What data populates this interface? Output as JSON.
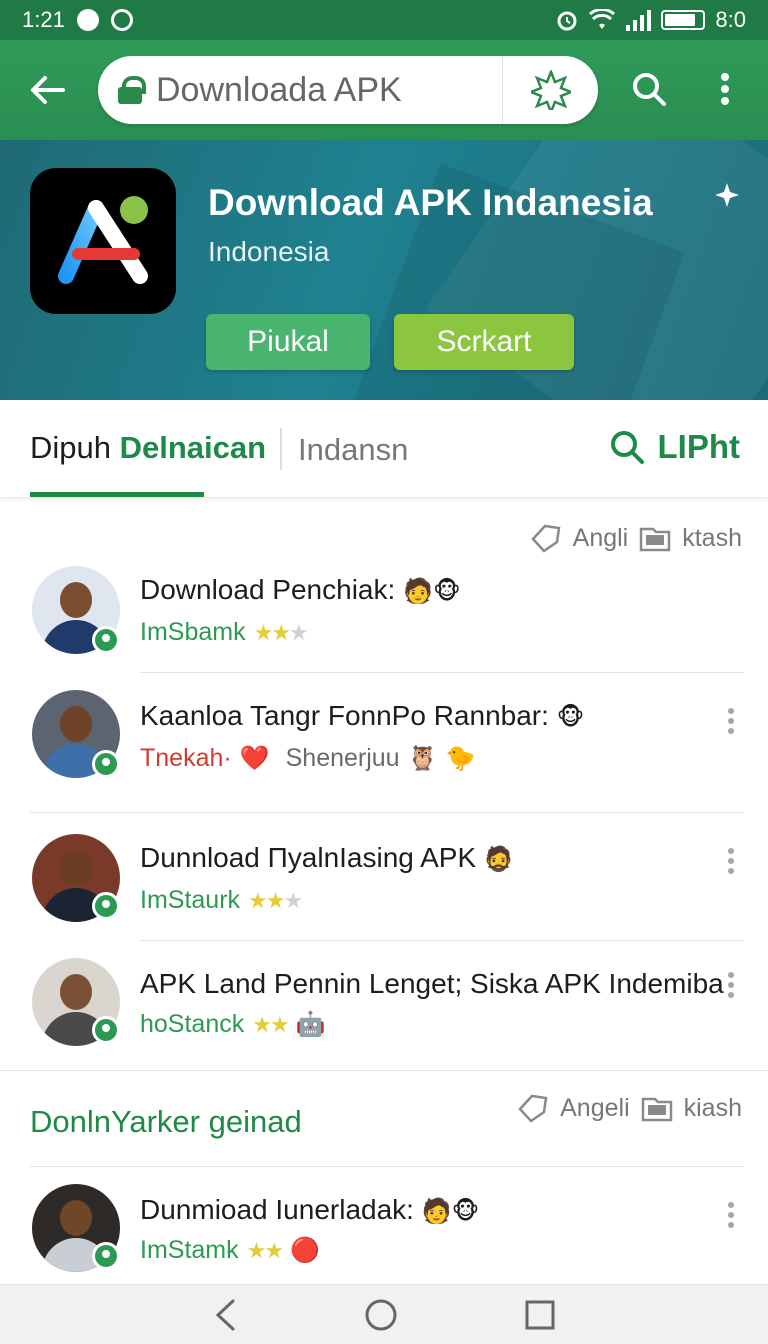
{
  "status_bar": {
    "time": "1:21",
    "battery_text": "8:0"
  },
  "toolbar": {
    "url": "Downloada APK"
  },
  "header": {
    "title": "Download APK Indanesia",
    "subtitle": "Indonesia",
    "primary_button": "Piukal",
    "secondary_button": "Scrkart"
  },
  "tabs": {
    "active_prefix": "Dipuh",
    "active_highlight": "Delnaican",
    "second": "Indansn",
    "right_action": "LIPht"
  },
  "filters": [
    {
      "label": "Angli",
      "action": "ktash"
    },
    {
      "label": "Angeli",
      "action": "kiash"
    }
  ],
  "items": [
    {
      "title": "Download Penchiak:",
      "meta_primary": "ImSbamk",
      "rating": 2,
      "rating_max": 3,
      "meta_secondary": "",
      "emojis": [
        "🧑",
        "🐵"
      ]
    },
    {
      "title": "Kaanloa Tangr FonnPo Rannbar:",
      "meta_primary": "Tnekah·",
      "rating": 0,
      "rating_max": 0,
      "meta_secondary": "Shenerjuu",
      "emojis": [
        "🐵"
      ],
      "meta_emojis": [
        "❤️",
        "🦉",
        "🐤"
      ]
    },
    {
      "title": "Dunnload ПyalnIasing APK",
      "meta_primary": "ImStaurk",
      "rating": 2,
      "rating_max": 3,
      "meta_secondary": "",
      "emojis": [
        "🧔"
      ]
    },
    {
      "title": "APK Land Pennin Lenget; Siska APK Indemiba",
      "meta_primary": "hoStanck",
      "rating": 2,
      "rating_max": 2,
      "meta_secondary": "",
      "emojis": [],
      "meta_emojis": [
        "🤖"
      ]
    },
    {
      "title": "Dunmioad Iunerladak:",
      "meta_primary": "ImStamk",
      "rating": 2,
      "rating_max": 2,
      "meta_secondary": "",
      "emojis": [
        "🧑",
        "🐵"
      ],
      "meta_emojis": [
        "🔴"
      ]
    }
  ],
  "section": {
    "title": "DonlnYarker geinad"
  },
  "icons": {
    "back": "back-arrow-icon",
    "lock": "lock-icon",
    "extension": "star-burst-icon",
    "search": "search-icon",
    "menu": "more-vert-icon",
    "sparkle": "sparkle-icon"
  },
  "colors": {
    "brand_green": "#2a8e52",
    "banner_teal": "#1f8190",
    "accent_green": "#1e8a48",
    "button_green": "#49b56f",
    "button_lime": "#8cc63f"
  }
}
